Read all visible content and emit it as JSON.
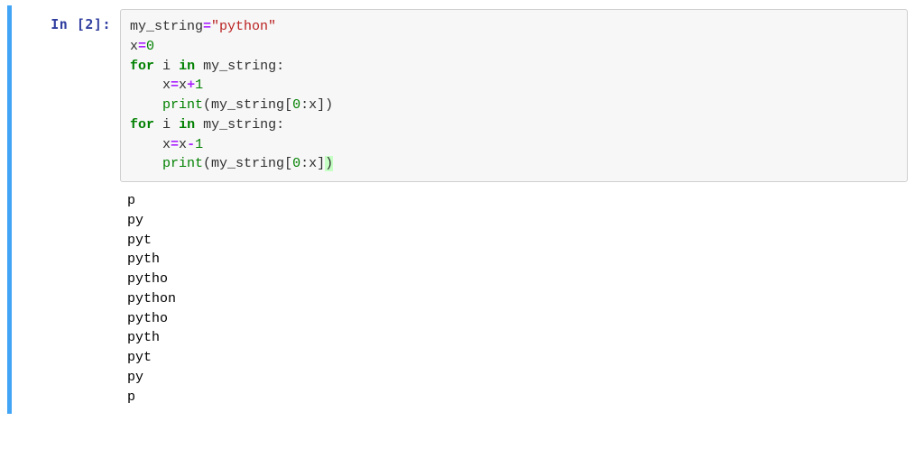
{
  "cell": {
    "prompt": "In [2]:",
    "code": {
      "l1": {
        "var1": "my_string",
        "eq": "=",
        "str": "\"python\""
      },
      "l2": {
        "var": "x",
        "eq": "=",
        "val": "0"
      },
      "l3": {
        "for": "for",
        "i": "i",
        "in": "in",
        "var": "my_string",
        "colon": ":"
      },
      "l4": {
        "indent": "    ",
        "x1": "x",
        "eq": "=",
        "x2": "x",
        "op": "+",
        "one": "1"
      },
      "l5": {
        "indent": "    ",
        "fn": "print",
        "lp": "(",
        "var": "my_string",
        "lb": "[",
        "z": "0",
        "colon": ":",
        "x": "x",
        "rb": "]",
        "rp": ")"
      },
      "l6": {
        "for": "for",
        "i": "i",
        "in": "in",
        "var": "my_string",
        "colon": ":"
      },
      "l7": {
        "indent": "    ",
        "x1": "x",
        "eq": "=",
        "x2": "x",
        "op": "-",
        "one": "1"
      },
      "l8": {
        "indent": "    ",
        "fn": "print",
        "lp": "(",
        "var": "my_string",
        "lb": "[",
        "z": "0",
        "colon": ":",
        "x": "x",
        "rb": "]",
        "rp": ")"
      }
    },
    "output": [
      "p",
      "py",
      "pyt",
      "pyth",
      "pytho",
      "python",
      "pytho",
      "pyth",
      "pyt",
      "py",
      "p"
    ]
  }
}
